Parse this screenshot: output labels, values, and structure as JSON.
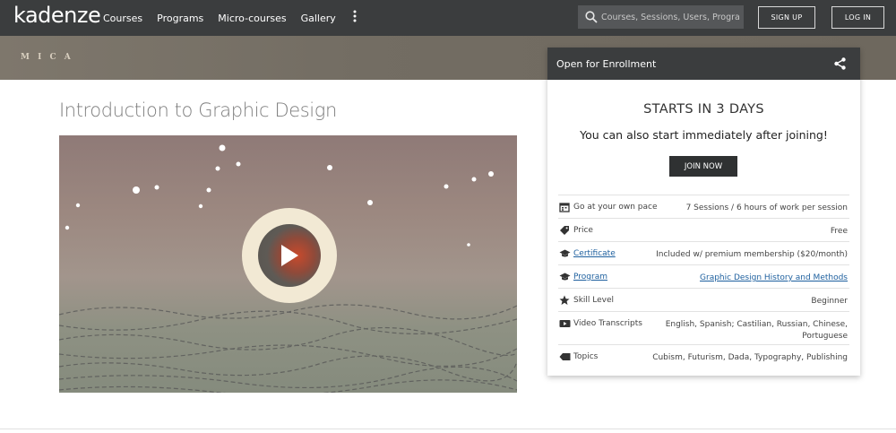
{
  "nav": {
    "logo": "kadenze",
    "links": [
      "Courses",
      "Programs",
      "Micro-courses",
      "Gallery"
    ],
    "more_icon": "vertical-dots-icon",
    "search_placeholder": "Courses, Sessions, Users, Programs",
    "signup_label": "SIGN UP",
    "login_label": "LOG IN"
  },
  "banner": {
    "institution": "M I C A"
  },
  "course": {
    "title": "Introduction to Graphic Design"
  },
  "enroll": {
    "header": "Open for Enrollment",
    "starts": "STARTS IN 3 DAYS",
    "subtitle": "You can also start immediately after joining!",
    "join_label": "JOIN NOW",
    "rows": [
      {
        "icon": "calendar-icon",
        "label": "Go at your own pace",
        "value": "7 Sessions / 6 hours of work per session",
        "label_link": false,
        "value_link": false
      },
      {
        "icon": "tag-icon",
        "label": "Price",
        "value": "Free",
        "label_link": false,
        "value_link": false
      },
      {
        "icon": "graduation-cap-icon",
        "label": "Certificate",
        "value": "Included w/ premium membership ($20/month)",
        "label_link": true,
        "value_link": false
      },
      {
        "icon": "graduation-cap-icon",
        "label": "Program",
        "value": "Graphic Design History and Methods",
        "label_link": true,
        "value_link": true
      },
      {
        "icon": "star-icon",
        "label": "Skill Level",
        "value": "Beginner",
        "label_link": false,
        "value_link": false
      },
      {
        "icon": "video-icon",
        "label": "Video Transcripts",
        "value_line1": "English, Spanish; Castilian, Russian, Chinese,",
        "value_line2": "Portuguese",
        "label_link": false,
        "value_link": false
      },
      {
        "icon": "label-tag-icon",
        "label": "Topics",
        "value": "Cubism, Futurism, Dada, Typography, Publishing",
        "label_link": false,
        "value_link": false
      }
    ]
  },
  "colors": {
    "navbar": "#3b3d3e",
    "link": "#1d5f9e",
    "button_dark": "#2f3132"
  }
}
